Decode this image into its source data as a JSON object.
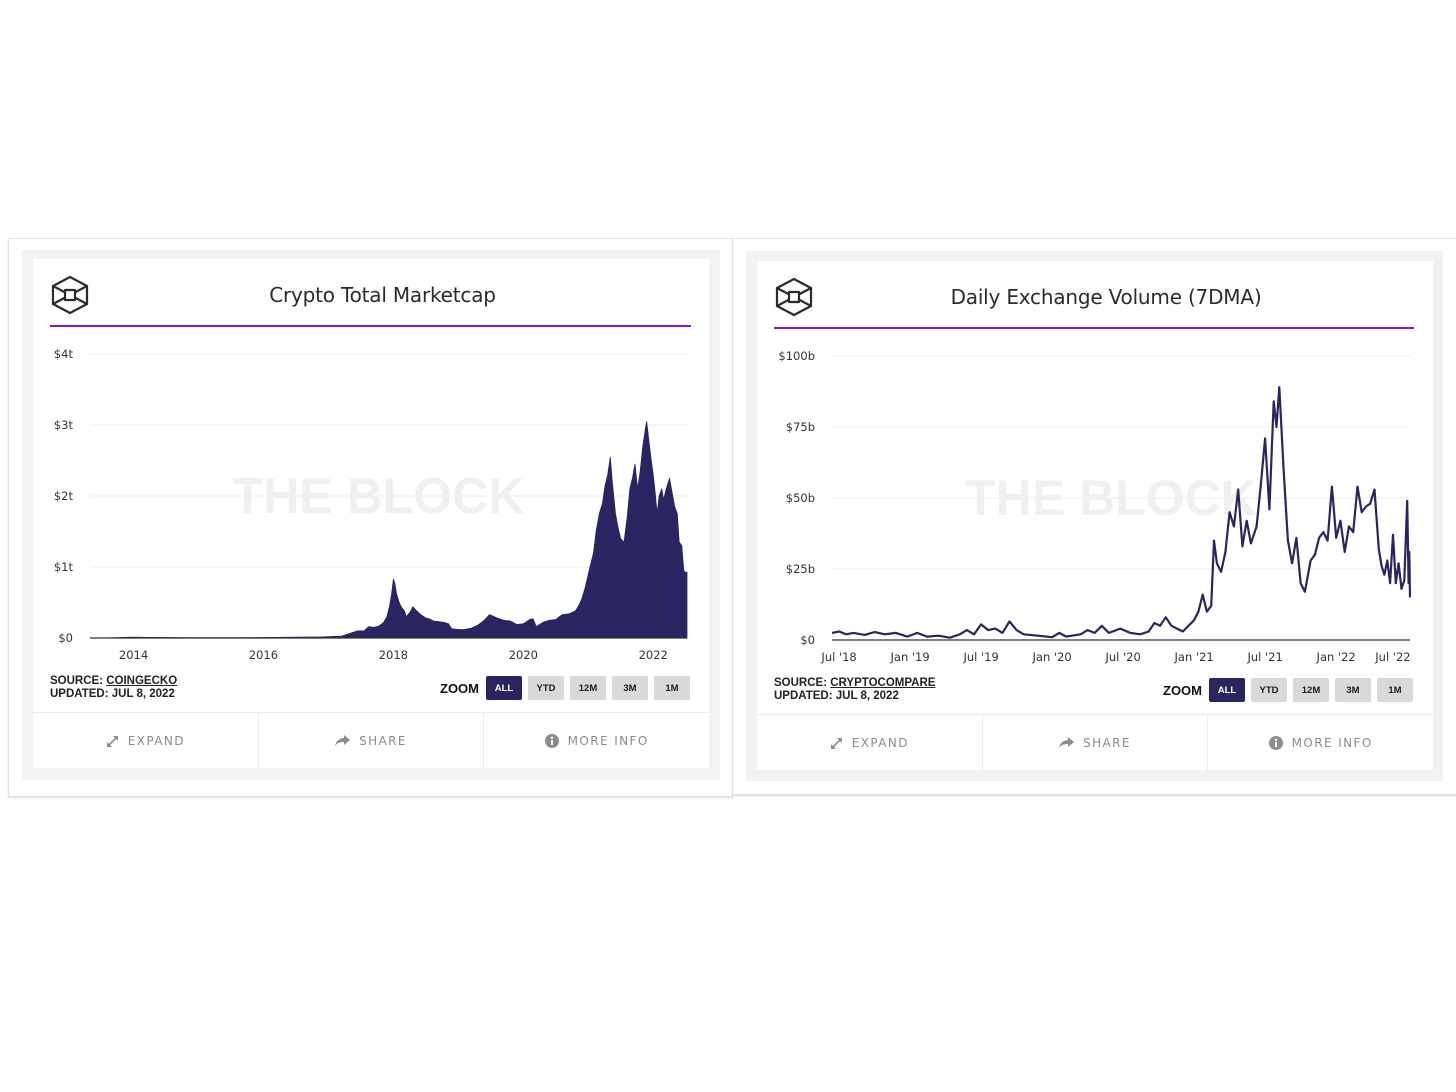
{
  "panels": [
    {
      "title": "Crypto Total Marketcap",
      "logo_icon": "the-block-cube-logo",
      "watermark": "THE BLOCK",
      "source_prefix": "SOURCE: ",
      "source_name": "COINGECKO",
      "updated": "UPDATED: JUL 8, 2022",
      "zoom_label": "ZOOM",
      "zoom_options": [
        "ALL",
        "YTD",
        "12M",
        "3M",
        "1M"
      ],
      "zoom_selected": "ALL",
      "actions": [
        {
          "label": "EXPAND",
          "icon": "expand-arrows-icon"
        },
        {
          "label": "SHARE",
          "icon": "share-arrow-icon"
        },
        {
          "label": "MORE INFO",
          "icon": "info-circle-icon"
        }
      ]
    },
    {
      "title": "Daily Exchange Volume (7DMA)",
      "logo_icon": "the-block-cube-logo",
      "watermark": "THE BLOCK",
      "source_prefix": "SOURCE: ",
      "source_name": "CRYPTOCOMPARE",
      "updated": "UPDATED: JUL 8, 2022",
      "zoom_label": "ZOOM",
      "zoom_options": [
        "ALL",
        "YTD",
        "12M",
        "3M",
        "1M"
      ],
      "zoom_selected": "ALL",
      "actions": [
        {
          "label": "EXPAND",
          "icon": "expand-arrows-icon"
        },
        {
          "label": "SHARE",
          "icon": "share-arrow-icon"
        },
        {
          "label": "MORE INFO",
          "icon": "info-circle-icon"
        }
      ]
    }
  ],
  "colors": {
    "series": "#2a2460",
    "accent_rule": "#8a12d8",
    "zoom_active_bg": "#2a2460",
    "zoom_inactive_bg": "#d9d9d9",
    "action_text": "#8c8c8c"
  },
  "chart_data": [
    {
      "type": "area",
      "title": "Crypto Total Marketcap",
      "xlabel": "",
      "ylabel": "",
      "x_unit": "year",
      "xlim": [
        2013.33,
        2022.52
      ],
      "ylim": [
        0,
        4
      ],
      "y_unit": "trillion USD",
      "y_ticks": [
        0,
        1,
        2,
        3,
        4
      ],
      "y_tick_labels": [
        "$0",
        "$1t",
        "$2t",
        "$3t",
        "$4t"
      ],
      "x_ticks": [
        2014,
        2016,
        2018,
        2020,
        2022
      ],
      "x_tick_labels": [
        "2014",
        "2016",
        "2018",
        "2020",
        "2022"
      ],
      "grid": true,
      "legend": "none",
      "series": [
        {
          "name": "Total Marketcap",
          "points": [
            [
              2013.33,
              0.001
            ],
            [
              2013.6,
              0.002
            ],
            [
              2013.9,
              0.01
            ],
            [
              2014.0,
              0.013
            ],
            [
              2014.2,
              0.008
            ],
            [
              2014.6,
              0.007
            ],
            [
              2015.0,
              0.005
            ],
            [
              2015.5,
              0.004
            ],
            [
              2016.0,
              0.007
            ],
            [
              2016.5,
              0.011
            ],
            [
              2016.9,
              0.016
            ],
            [
              2017.2,
              0.025
            ],
            [
              2017.35,
              0.07
            ],
            [
              2017.45,
              0.1
            ],
            [
              2017.55,
              0.1
            ],
            [
              2017.62,
              0.16
            ],
            [
              2017.7,
              0.15
            ],
            [
              2017.78,
              0.17
            ],
            [
              2017.85,
              0.22
            ],
            [
              2017.9,
              0.3
            ],
            [
              2017.94,
              0.45
            ],
            [
              2017.97,
              0.6
            ],
            [
              2018.0,
              0.83
            ],
            [
              2018.02,
              0.78
            ],
            [
              2018.05,
              0.62
            ],
            [
              2018.09,
              0.5
            ],
            [
              2018.12,
              0.44
            ],
            [
              2018.17,
              0.38
            ],
            [
              2018.2,
              0.3
            ],
            [
              2018.26,
              0.37
            ],
            [
              2018.3,
              0.44
            ],
            [
              2018.36,
              0.38
            ],
            [
              2018.42,
              0.33
            ],
            [
              2018.5,
              0.28
            ],
            [
              2018.55,
              0.27
            ],
            [
              2018.62,
              0.24
            ],
            [
              2018.7,
              0.23
            ],
            [
              2018.78,
              0.22
            ],
            [
              2018.85,
              0.2
            ],
            [
              2018.9,
              0.13
            ],
            [
              2019.0,
              0.12
            ],
            [
              2019.1,
              0.12
            ],
            [
              2019.2,
              0.14
            ],
            [
              2019.3,
              0.18
            ],
            [
              2019.4,
              0.25
            ],
            [
              2019.48,
              0.33
            ],
            [
              2019.53,
              0.31
            ],
            [
              2019.6,
              0.28
            ],
            [
              2019.7,
              0.25
            ],
            [
              2019.8,
              0.24
            ],
            [
              2019.9,
              0.19
            ],
            [
              2020.0,
              0.2
            ],
            [
              2020.1,
              0.26
            ],
            [
              2020.15,
              0.27
            ],
            [
              2020.2,
              0.16
            ],
            [
              2020.3,
              0.22
            ],
            [
              2020.4,
              0.25
            ],
            [
              2020.5,
              0.26
            ],
            [
              2020.6,
              0.33
            ],
            [
              2020.7,
              0.34
            ],
            [
              2020.8,
              0.38
            ],
            [
              2020.85,
              0.45
            ],
            [
              2020.9,
              0.55
            ],
            [
              2020.95,
              0.7
            ],
            [
              2021.0,
              0.9
            ],
            [
              2021.04,
              1.05
            ],
            [
              2021.08,
              1.2
            ],
            [
              2021.12,
              1.5
            ],
            [
              2021.17,
              1.75
            ],
            [
              2021.22,
              1.9
            ],
            [
              2021.26,
              2.15
            ],
            [
              2021.3,
              2.3
            ],
            [
              2021.34,
              2.55
            ],
            [
              2021.37,
              2.2
            ],
            [
              2021.42,
              1.75
            ],
            [
              2021.46,
              1.55
            ],
            [
              2021.5,
              1.4
            ],
            [
              2021.55,
              1.35
            ],
            [
              2021.6,
              1.7
            ],
            [
              2021.64,
              2.1
            ],
            [
              2021.68,
              2.25
            ],
            [
              2021.72,
              2.45
            ],
            [
              2021.76,
              2.1
            ],
            [
              2021.8,
              2.35
            ],
            [
              2021.84,
              2.7
            ],
            [
              2021.88,
              2.95
            ],
            [
              2021.9,
              3.05
            ],
            [
              2021.93,
              2.8
            ],
            [
              2021.97,
              2.5
            ],
            [
              2022.0,
              2.3
            ],
            [
              2022.03,
              2.05
            ],
            [
              2022.06,
              1.75
            ],
            [
              2022.09,
              2.0
            ],
            [
              2022.13,
              2.1
            ],
            [
              2022.16,
              1.95
            ],
            [
              2022.2,
              2.1
            ],
            [
              2022.25,
              2.25
            ],
            [
              2022.29,
              2.05
            ],
            [
              2022.33,
              1.85
            ],
            [
              2022.37,
              1.75
            ],
            [
              2022.4,
              1.35
            ],
            [
              2022.44,
              1.3
            ],
            [
              2022.47,
              0.95
            ],
            [
              2022.5,
              0.92
            ],
            [
              2022.52,
              0.93
            ]
          ]
        }
      ]
    },
    {
      "type": "line",
      "title": "Daily Exchange Volume (7DMA)",
      "xlabel": "",
      "ylabel": "",
      "x_unit": "year",
      "xlim": [
        2018.45,
        2022.52
      ],
      "ylim": [
        0,
        100
      ],
      "y_unit": "billion USD",
      "y_ticks": [
        0,
        25,
        50,
        75,
        100
      ],
      "y_tick_labels": [
        "$0",
        "$25b",
        "$50b",
        "$75b",
        "$100b"
      ],
      "x_ticks": [
        2018.5,
        2019.0,
        2019.5,
        2020.0,
        2020.5,
        2021.0,
        2021.5,
        2022.0,
        2022.4
      ],
      "x_tick_labels": [
        "Jul '18",
        "Jan '19",
        "Jul '19",
        "Jan '20",
        "Jul '20",
        "Jan '21",
        "Jul '21",
        "Jan '22",
        "Jul '22"
      ],
      "grid": true,
      "legend": "none",
      "series": [
        {
          "name": "Daily Exchange Volume (7DMA)",
          "points": [
            [
              2018.45,
              2.5
            ],
            [
              2018.5,
              3
            ],
            [
              2018.55,
              2
            ],
            [
              2018.6,
              2.5
            ],
            [
              2018.68,
              1.8
            ],
            [
              2018.75,
              2.8
            ],
            [
              2018.82,
              2
            ],
            [
              2018.9,
              2.5
            ],
            [
              2018.98,
              1.2
            ],
            [
              2019.05,
              2.5
            ],
            [
              2019.12,
              1.2
            ],
            [
              2019.2,
              1.5
            ],
            [
              2019.28,
              0.8
            ],
            [
              2019.35,
              2
            ],
            [
              2019.4,
              3.5
            ],
            [
              2019.45,
              2
            ],
            [
              2019.5,
              5.5
            ],
            [
              2019.55,
              3.5
            ],
            [
              2019.6,
              4
            ],
            [
              2019.65,
              2.5
            ],
            [
              2019.7,
              6.5
            ],
            [
              2019.75,
              3.5
            ],
            [
              2019.8,
              2
            ],
            [
              2019.9,
              1.5
            ],
            [
              2020.0,
              1
            ],
            [
              2020.05,
              2.5
            ],
            [
              2020.1,
              1.2
            ],
            [
              2020.2,
              2
            ],
            [
              2020.25,
              3.5
            ],
            [
              2020.3,
              2.5
            ],
            [
              2020.35,
              5
            ],
            [
              2020.4,
              2.5
            ],
            [
              2020.48,
              4
            ],
            [
              2020.55,
              2.5
            ],
            [
              2020.62,
              2
            ],
            [
              2020.68,
              3
            ],
            [
              2020.72,
              6
            ],
            [
              2020.76,
              5
            ],
            [
              2020.8,
              8
            ],
            [
              2020.84,
              5
            ],
            [
              2020.88,
              4
            ],
            [
              2020.92,
              3
            ],
            [
              2020.96,
              5
            ],
            [
              2021.0,
              7
            ],
            [
              2021.03,
              10
            ],
            [
              2021.06,
              16
            ],
            [
              2021.09,
              10
            ],
            [
              2021.12,
              12
            ],
            [
              2021.14,
              35
            ],
            [
              2021.16,
              27
            ],
            [
              2021.19,
              24
            ],
            [
              2021.22,
              31
            ],
            [
              2021.25,
              45
            ],
            [
              2021.28,
              40
            ],
            [
              2021.31,
              53
            ],
            [
              2021.34,
              33
            ],
            [
              2021.37,
              42
            ],
            [
              2021.4,
              34
            ],
            [
              2021.44,
              40
            ],
            [
              2021.47,
              55
            ],
            [
              2021.5,
              71
            ],
            [
              2021.53,
              46
            ],
            [
              2021.56,
              84
            ],
            [
              2021.58,
              75
            ],
            [
              2021.6,
              89
            ],
            [
              2021.63,
              60
            ],
            [
              2021.66,
              35
            ],
            [
              2021.69,
              27
            ],
            [
              2021.72,
              36
            ],
            [
              2021.75,
              20
            ],
            [
              2021.78,
              17
            ],
            [
              2021.82,
              28
            ],
            [
              2021.85,
              30
            ],
            [
              2021.88,
              36
            ],
            [
              2021.91,
              38
            ],
            [
              2021.94,
              35
            ],
            [
              2021.97,
              54
            ],
            [
              2022.0,
              36
            ],
            [
              2022.03,
              42
            ],
            [
              2022.06,
              31
            ],
            [
              2022.09,
              40
            ],
            [
              2022.12,
              38
            ],
            [
              2022.15,
              54
            ],
            [
              2022.18,
              45
            ],
            [
              2022.21,
              47
            ],
            [
              2022.24,
              48
            ],
            [
              2022.27,
              53
            ],
            [
              2022.3,
              32
            ],
            [
              2022.32,
              26
            ],
            [
              2022.34,
              23
            ],
            [
              2022.36,
              28
            ],
            [
              2022.38,
              20
            ],
            [
              2022.4,
              37
            ],
            [
              2022.42,
              20
            ],
            [
              2022.44,
              27
            ],
            [
              2022.46,
              18
            ],
            [
              2022.48,
              21
            ],
            [
              2022.5,
              49
            ],
            [
              2022.51,
              20
            ],
            [
              2022.515,
              31
            ],
            [
              2022.52,
              15
            ]
          ]
        }
      ]
    }
  ]
}
